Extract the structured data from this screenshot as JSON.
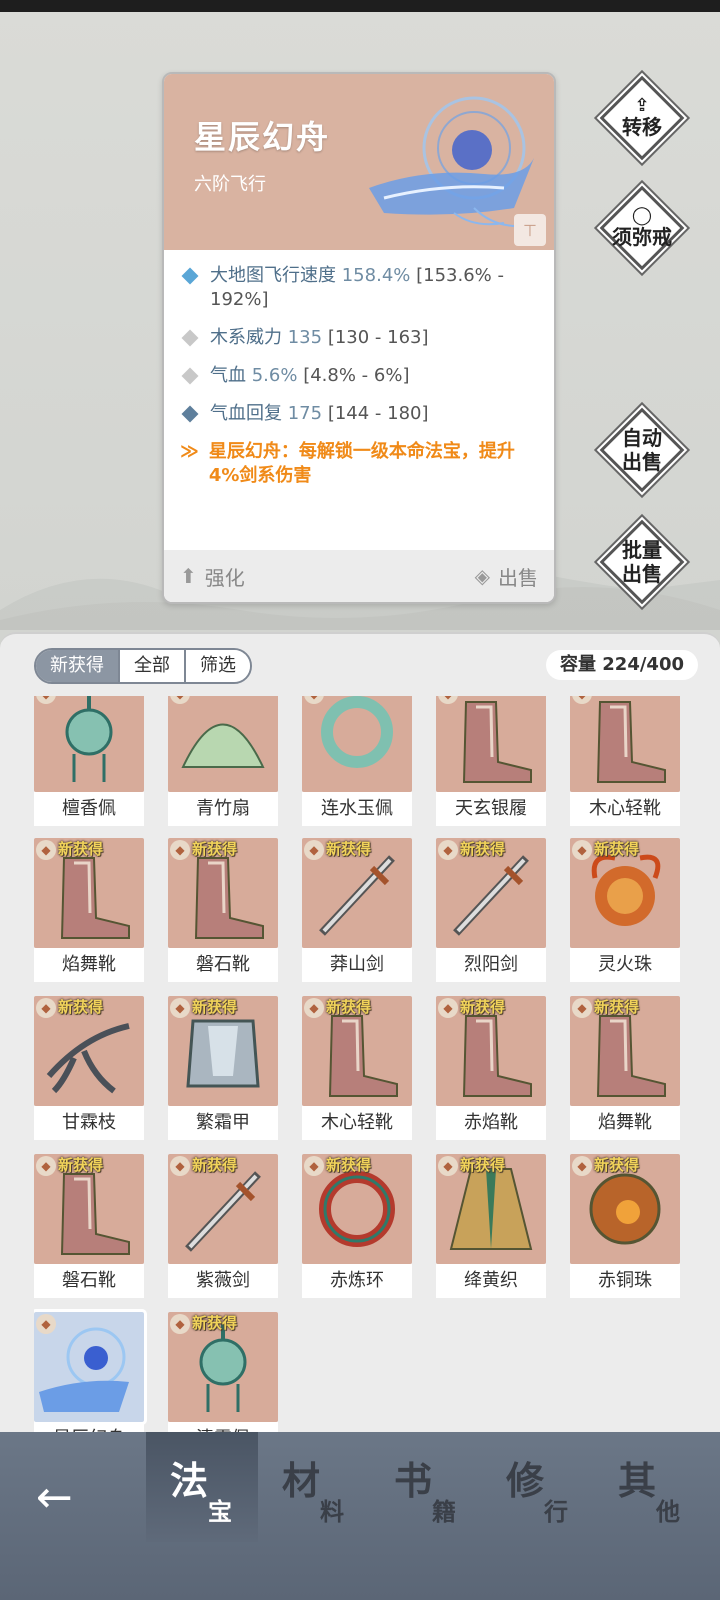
{
  "item_detail": {
    "title": "星辰幻舟",
    "subtitle": "六阶飞行",
    "stats": [
      {
        "label": "大地图飞行速度",
        "value": "158.4%",
        "range": "[153.6% - 192%]",
        "color": "#5aa6d6"
      },
      {
        "label": "木系威力",
        "value": "135",
        "range": "[130 - 163]",
        "color": "#c8c8c8"
      },
      {
        "label": "气血",
        "value": "5.6%",
        "range": "[4.8% - 6%]",
        "color": "#c8c8c8"
      },
      {
        "label": "气血回复",
        "value": "175",
        "range": "[144 - 180]",
        "color": "#5e7f9c"
      }
    ],
    "special": "星辰幻舟：每解锁一级本命法宝，提升4%剑系伤害",
    "enhance_label": "强化",
    "sell_label": "出售"
  },
  "side_buttons": {
    "transfer": "转移",
    "ring": "须弥戒",
    "auto_sell": "自动出售",
    "batch_sell": "批量出售"
  },
  "inventory": {
    "tabs": [
      "新获得",
      "全部",
      "筛选"
    ],
    "active_tab": 0,
    "capacity": "容量 224/400",
    "new_badge": "新获得",
    "items": [
      {
        "name": "檀香佩",
        "new": false,
        "icon": "pendant-icon"
      },
      {
        "name": "青竹扇",
        "new": false,
        "icon": "fan-icon"
      },
      {
        "name": "连水玉佩",
        "new": false,
        "icon": "jade-ring-icon"
      },
      {
        "name": "天玄银履",
        "new": false,
        "icon": "boots-icon"
      },
      {
        "name": "木心轻靴",
        "new": false,
        "icon": "boots-icon"
      },
      {
        "name": "焰舞靴",
        "new": true,
        "icon": "boots-icon"
      },
      {
        "name": "磐石靴",
        "new": true,
        "icon": "boots-icon"
      },
      {
        "name": "莽山剑",
        "new": true,
        "icon": "sword-icon"
      },
      {
        "name": "烈阳剑",
        "new": true,
        "icon": "sword-icon"
      },
      {
        "name": "灵火珠",
        "new": true,
        "icon": "fire-orb-icon"
      },
      {
        "name": "甘霖枝",
        "new": true,
        "icon": "branch-icon"
      },
      {
        "name": "繁霜甲",
        "new": true,
        "icon": "armor-icon"
      },
      {
        "name": "木心轻靴",
        "new": true,
        "icon": "boots-icon"
      },
      {
        "name": "赤焰靴",
        "new": true,
        "icon": "boots-icon"
      },
      {
        "name": "焰舞靴",
        "new": true,
        "icon": "boots-icon"
      },
      {
        "name": "磐石靴",
        "new": true,
        "icon": "boots-icon"
      },
      {
        "name": "紫薇剑",
        "new": true,
        "icon": "sword-icon"
      },
      {
        "name": "赤炼环",
        "new": true,
        "icon": "ring-icon"
      },
      {
        "name": "绛黄织",
        "new": true,
        "icon": "robe-icon"
      },
      {
        "name": "赤铜珠",
        "new": true,
        "icon": "orb-icon"
      },
      {
        "name": "星辰幻舟",
        "new": false,
        "icon": "flying-boat-icon",
        "selected": true
      },
      {
        "name": "清霜佩",
        "new": true,
        "icon": "pendant-icon"
      }
    ]
  },
  "bottom_nav": {
    "back": "←",
    "tabs": [
      {
        "big": "法",
        "small": "宝"
      },
      {
        "big": "材",
        "small": "料"
      },
      {
        "big": "书",
        "small": "籍"
      },
      {
        "big": "修",
        "small": "行"
      },
      {
        "big": "其",
        "small": "他"
      }
    ],
    "active": 0
  }
}
